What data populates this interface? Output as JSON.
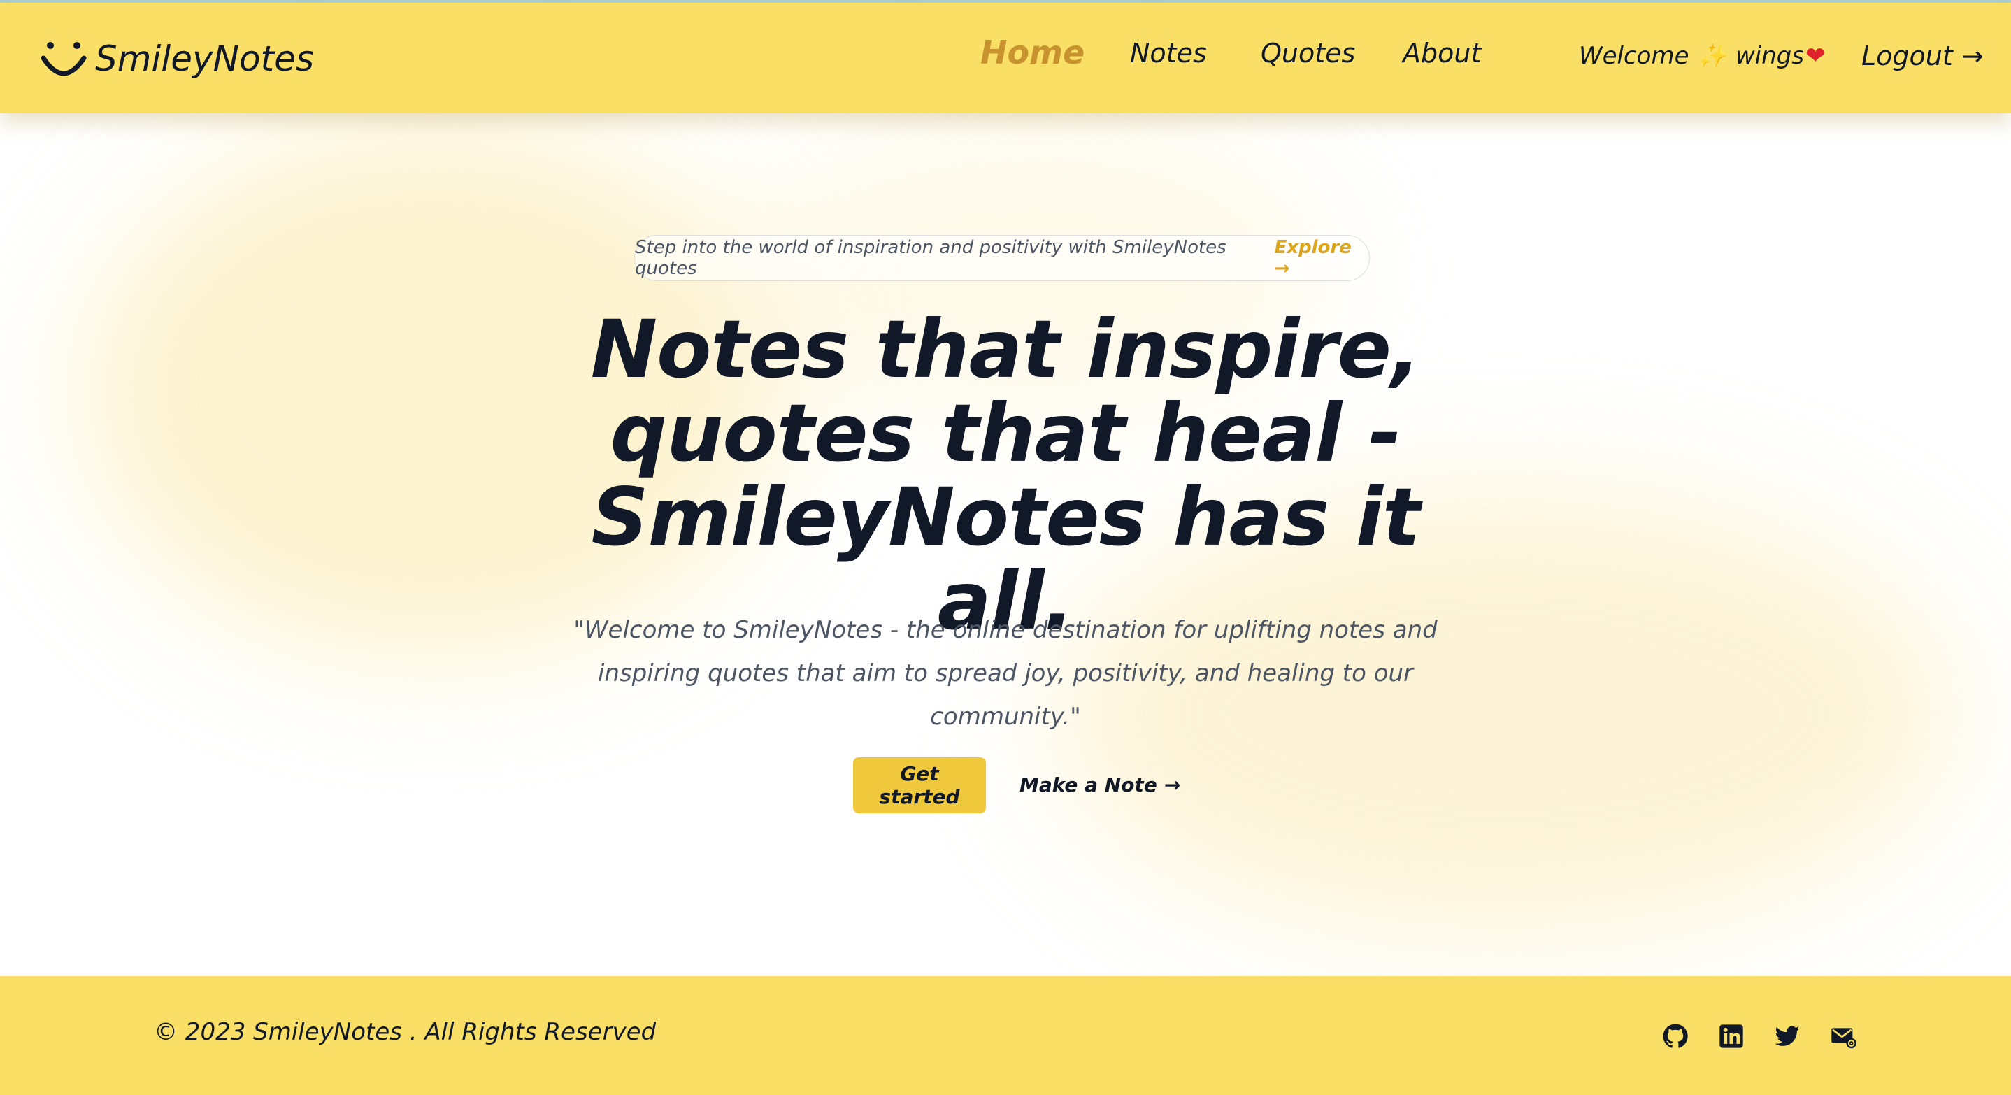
{
  "brand": {
    "name": "SmileyNotes",
    "accent": "#f9df66",
    "active_link_color": "#c8922f"
  },
  "nav": {
    "links": [
      "Home",
      "Notes",
      "Quotes",
      "About"
    ],
    "active": "Home"
  },
  "user": {
    "welcome": "Welcome",
    "name": "wings",
    "spark_icon": "✨",
    "heart_icon": "❤"
  },
  "logout": {
    "label": "Logout",
    "arrow": "→"
  },
  "announcement": {
    "text": "Step into the world of inspiration and positivity with SmileyNotes quotes",
    "link": "Explore",
    "arrow": "→"
  },
  "hero": {
    "title": "Notes that inspire, quotes that heal - SmileyNotes has it all.",
    "subtitle": "\"Welcome to SmileyNotes - the online destination for uplifting notes and inspiring quotes that aim to spread joy, positivity, and healing to our community.\""
  },
  "actions": {
    "primary": "Get started",
    "secondary": "Make a Note",
    "secondary_arrow": "→"
  },
  "footer": {
    "copyright": "© 2023 SmileyNotes . All Rights Reserved",
    "social_icons": [
      "github-icon",
      "linkedin-icon",
      "twitter-icon",
      "mail-icon"
    ]
  }
}
